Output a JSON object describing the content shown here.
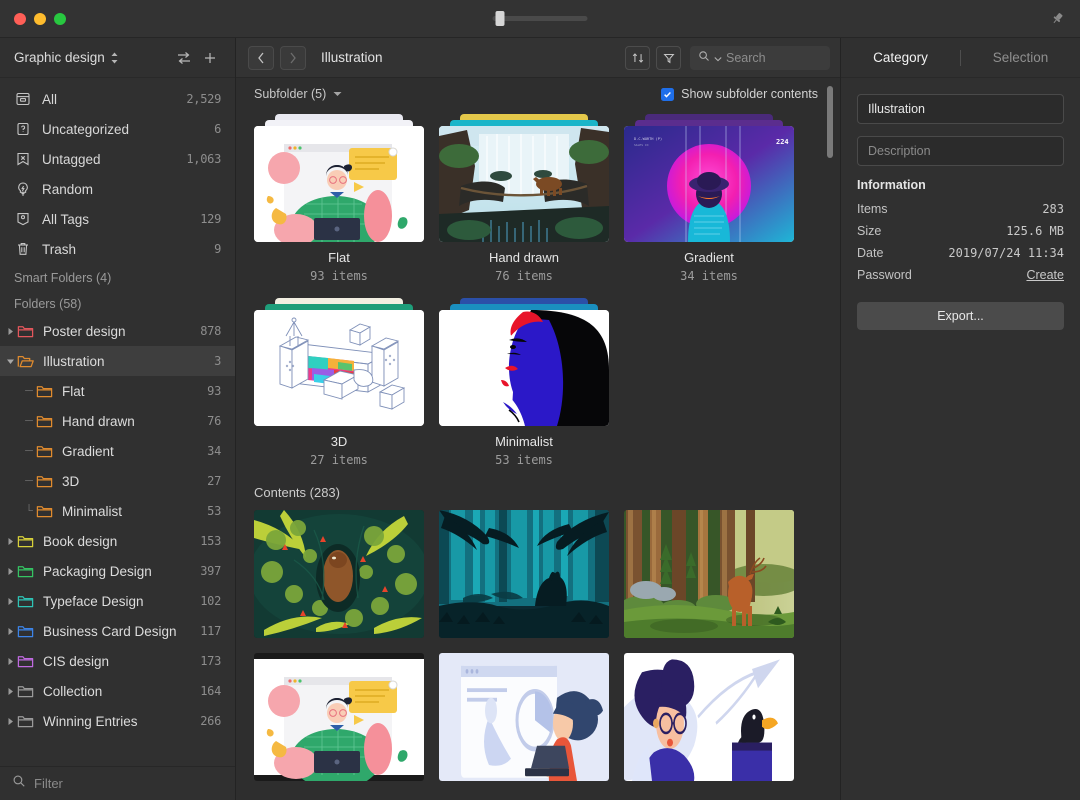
{
  "titlebar": {
    "pin_icon": "pin-icon",
    "zoom_percent": 20
  },
  "sidebar": {
    "library_name": "Graphic design",
    "switch_icon": "switch-library-icon",
    "add_icon": "plus-icon",
    "nav_items": [
      {
        "icon": "archive-box-icon",
        "label": "All",
        "count": "2,529"
      },
      {
        "icon": "tag-question-icon",
        "label": "Uncategorized",
        "count": "6"
      },
      {
        "icon": "tag-cross-icon",
        "label": "Untagged",
        "count": "1,063"
      },
      {
        "icon": "lightbulb-icon",
        "label": "Random",
        "count": ""
      },
      {
        "icon": "bookmark-icon",
        "label": "All Tags",
        "count": "129"
      },
      {
        "icon": "trash-icon",
        "label": "Trash",
        "count": "9"
      }
    ],
    "smart_folders_label": "Smart Folders (4)",
    "folders_label": "Folders (58)",
    "folders": [
      {
        "label": "Poster design",
        "count": "878",
        "color": "#e4575c",
        "level": 0,
        "expanded": false,
        "selected": false,
        "has_children": true
      },
      {
        "label": "Illustration",
        "count": "3",
        "color": "#e08b2e",
        "level": 0,
        "expanded": true,
        "selected": true,
        "has_children": true
      },
      {
        "label": "Flat",
        "count": "93",
        "color": "#e08b2e",
        "level": 1,
        "expanded": false,
        "selected": false,
        "has_children": false
      },
      {
        "label": "Hand drawn",
        "count": "76",
        "color": "#e08b2e",
        "level": 1,
        "expanded": false,
        "selected": false,
        "has_children": false
      },
      {
        "label": "Gradient",
        "count": "34",
        "color": "#e08b2e",
        "level": 1,
        "expanded": false,
        "selected": false,
        "has_children": false
      },
      {
        "label": "3D",
        "count": "27",
        "color": "#e08b2e",
        "level": 1,
        "expanded": false,
        "selected": false,
        "has_children": false
      },
      {
        "label": "Minimalist",
        "count": "53",
        "color": "#e08b2e",
        "level": 1,
        "expanded": false,
        "selected": false,
        "has_children": false
      },
      {
        "label": "Book design",
        "count": "153",
        "color": "#d8d13a",
        "level": 0,
        "expanded": false,
        "selected": false,
        "has_children": true
      },
      {
        "label": "Packaging Design",
        "count": "397",
        "color": "#35c463",
        "level": 0,
        "expanded": false,
        "selected": false,
        "has_children": true
      },
      {
        "label": "Typeface Design",
        "count": "102",
        "color": "#2ec4b6",
        "level": 0,
        "expanded": false,
        "selected": false,
        "has_children": true
      },
      {
        "label": "Business Card Design",
        "count": "117",
        "color": "#3d84e8",
        "level": 0,
        "expanded": false,
        "selected": false,
        "has_children": true
      },
      {
        "label": "CIS design",
        "count": "173",
        "color": "#c06ae0",
        "level": 0,
        "expanded": false,
        "selected": false,
        "has_children": true
      },
      {
        "label": "Collection",
        "count": "164",
        "color": "#9a9a9a",
        "level": 0,
        "expanded": false,
        "selected": false,
        "has_children": true
      },
      {
        "label": "Winning Entries",
        "count": "266",
        "color": "#9a9a9a",
        "level": 0,
        "expanded": false,
        "selected": false,
        "has_children": true
      }
    ],
    "filter_placeholder": "Filter",
    "filter_icon": "search-icon"
  },
  "toolbar": {
    "back_icon": "chevron-left-icon",
    "forward_icon": "chevron-right-icon",
    "breadcrumb": "Illustration",
    "sort_icon": "sort-icon",
    "filter_icon": "funnel-icon",
    "search_icon": "search-icon",
    "search_dropdown_icon": "chevron-down-icon",
    "search_placeholder": "Search",
    "search_value": ""
  },
  "subbar": {
    "subfolder_label": "Subfolder (5)",
    "dropdown_icon": "chevron-down-icon",
    "show_subfolder_label": "Show subfolder contents",
    "show_subfolder_checked": true,
    "check_icon": "check-icon",
    "accent": "#1f6fea"
  },
  "content": {
    "folders": [
      {
        "name": "Flat",
        "count": "93 items",
        "thumb": "flat",
        "sheet1": "#e8e8f0",
        "sheet2": "#f2f2f7"
      },
      {
        "name": "Hand drawn",
        "count": "76 items",
        "thumb": "handdrawn",
        "sheet1": "#e4c84a",
        "sheet2": "#1ab5c9"
      },
      {
        "name": "Gradient",
        "count": "34 items",
        "thumb": "gradient",
        "sheet1": "#4a2a7a",
        "sheet2": "#5b2d8e"
      },
      {
        "name": "3D",
        "count": "27 items",
        "thumb": "threed",
        "sheet1": "#f2efe2",
        "sheet2": "#1e9e7a"
      },
      {
        "name": "Minimalist",
        "count": "53 items",
        "thumb": "minimalist",
        "sheet1": "#2b4fa8",
        "sheet2": "#1a8fbf"
      }
    ],
    "contents_label": "Contents (283)",
    "images": [
      {
        "id": "bear-lilypads"
      },
      {
        "id": "teal-forest-wolf"
      },
      {
        "id": "deer-forest"
      },
      {
        "id": "flat-man-laptop"
      },
      {
        "id": "woman-dashboard"
      },
      {
        "id": "woman-toucan"
      }
    ]
  },
  "inspector": {
    "tabs": [
      {
        "label": "Category",
        "active": true
      },
      {
        "label": "Selection",
        "active": false
      }
    ],
    "name_value": "Illustration",
    "description_placeholder": "Description",
    "description_value": "",
    "information_title": "Information",
    "info": [
      {
        "key": "Items",
        "value": "283",
        "link": false
      },
      {
        "key": "Size",
        "value": "125.6 MB",
        "link": false
      },
      {
        "key": "Date",
        "value": "2019/07/24 11:34",
        "link": false
      },
      {
        "key": "Password",
        "value": "Create",
        "link": true
      }
    ],
    "export_label": "Export..."
  }
}
